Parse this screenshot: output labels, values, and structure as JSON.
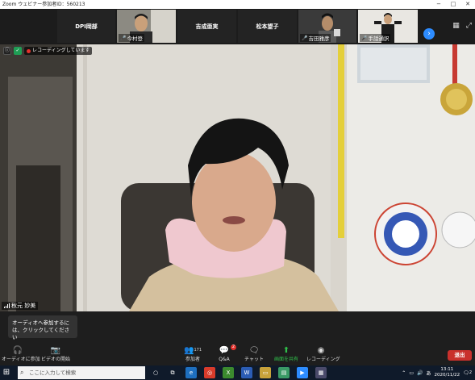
{
  "window": {
    "title": "Zoom ウェビナー参加者ID：560213",
    "minimize": "−",
    "maximize": "□",
    "close": "✕"
  },
  "gallery": {
    "participants": [
      {
        "name": "DPI岡部",
        "video": false
      },
      {
        "name": "今村登",
        "video": true
      },
      {
        "name": "吉成亜実",
        "video": false
      },
      {
        "name": "松本望子",
        "video": false
      },
      {
        "name": "吉田雅彦",
        "video": true
      },
      {
        "name": "手話通訳",
        "video": true
      }
    ],
    "next_icon": "›"
  },
  "main": {
    "recording_label": "レコーディングしています",
    "speaker_name": "秋元 妙美"
  },
  "bottom": {
    "tooltip": "オーディオへ参加するには、クリックしてください",
    "buttons": {
      "join_audio": "オーディオに参加",
      "start_video": "ビデオの開始",
      "participants": "参加者",
      "participants_count": "171",
      "qa": "Q&A",
      "qa_badge": "2",
      "chat": "チャット",
      "share": "画面を共有",
      "record": "レコーディング"
    },
    "leave": "退出"
  },
  "taskbar": {
    "search_placeholder": "ここに入力して検索",
    "ime": "あ",
    "time": "13:11",
    "date": "2020/11/22",
    "notifications": "2"
  },
  "colors": {
    "accent": "#2d8cff",
    "danger": "#c9302c",
    "recording": "#e5322d"
  }
}
